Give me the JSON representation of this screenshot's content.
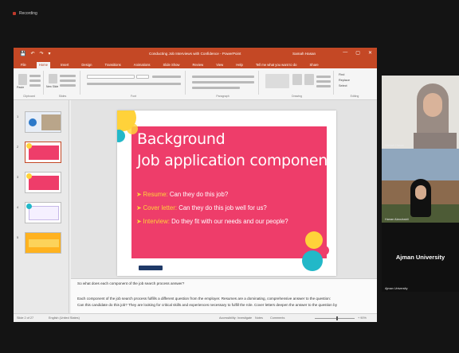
{
  "meeting": {
    "window_title": "Recording",
    "title_color": "#c0392b"
  },
  "ppt": {
    "doc_title": "Conducting Job Interviews with Confidence - PowerPoint",
    "user_name": "Samah Hasan",
    "quick_access": [
      "💾",
      "↶",
      "↷",
      "▾"
    ],
    "window_controls": [
      "—",
      "▢",
      "✕"
    ],
    "tabs": [
      {
        "label": "File",
        "active": false
      },
      {
        "label": "Home",
        "active": true
      },
      {
        "label": "Insert",
        "active": false
      },
      {
        "label": "Design",
        "active": false
      },
      {
        "label": "Transitions",
        "active": false
      },
      {
        "label": "Animations",
        "active": false
      },
      {
        "label": "Slide Show",
        "active": false
      },
      {
        "label": "Review",
        "active": false
      },
      {
        "label": "View",
        "active": false
      },
      {
        "label": "Help",
        "active": false
      },
      {
        "label": "Tell me what you want to do",
        "active": false
      },
      {
        "label": "Share",
        "active": false
      }
    ],
    "ribbon_groups": [
      "Clipboard",
      "Slides",
      "Font",
      "Paragraph",
      "Drawing",
      "Editing"
    ],
    "ribbon_buttons": {
      "paste": "Paste",
      "new_slide": "New Slide",
      "find": "Find",
      "replace": "Replace",
      "select": "Select"
    },
    "accent_color": "#c44825"
  },
  "slide": {
    "title_line1": "Background",
    "title_line2": "Job application components",
    "bullets": [
      {
        "label": "Resume:",
        "text": "Can they do this job?"
      },
      {
        "label": "Cover letter:",
        "text": "Can they do this job well for us?"
      },
      {
        "label": "Interview:",
        "text": "Do they fit with our needs and our people?"
      }
    ],
    "panel_color": "#ee3d6a",
    "accent_yellow": "#ffd23a",
    "accent_teal": "#22b8c8"
  },
  "thumbnails": [
    {
      "num": "1",
      "selected": false
    },
    {
      "num": "2",
      "selected": true
    },
    {
      "num": "3",
      "selected": false
    },
    {
      "num": "4",
      "selected": false
    },
    {
      "num": "5",
      "selected": false
    }
  ],
  "notes": {
    "question": "So what does each component of the job search process answer?",
    "line1": "Each component of the job search process fulfills a different question from the employer. Resumes are a dominating, comprehensive answer to the question:",
    "line2": "Can this candidate do this job? They are looking for critical skills and experiences necessary to fulfill the role. Cover letters deepen the answer to the question by"
  },
  "status": {
    "slide_info": "Slide 2 of 27",
    "language": "English (United States)",
    "accessibility": "Accessibility: Investigate",
    "notes_btn": "Notes",
    "comments_btn": "Comments",
    "zoom": "+ 90%"
  },
  "participants": [
    {
      "name": "Samah Hasan"
    },
    {
      "name": "Hanan Alzoubaidi"
    },
    {
      "name": "Ajman University",
      "label": "Ajman University"
    }
  ]
}
